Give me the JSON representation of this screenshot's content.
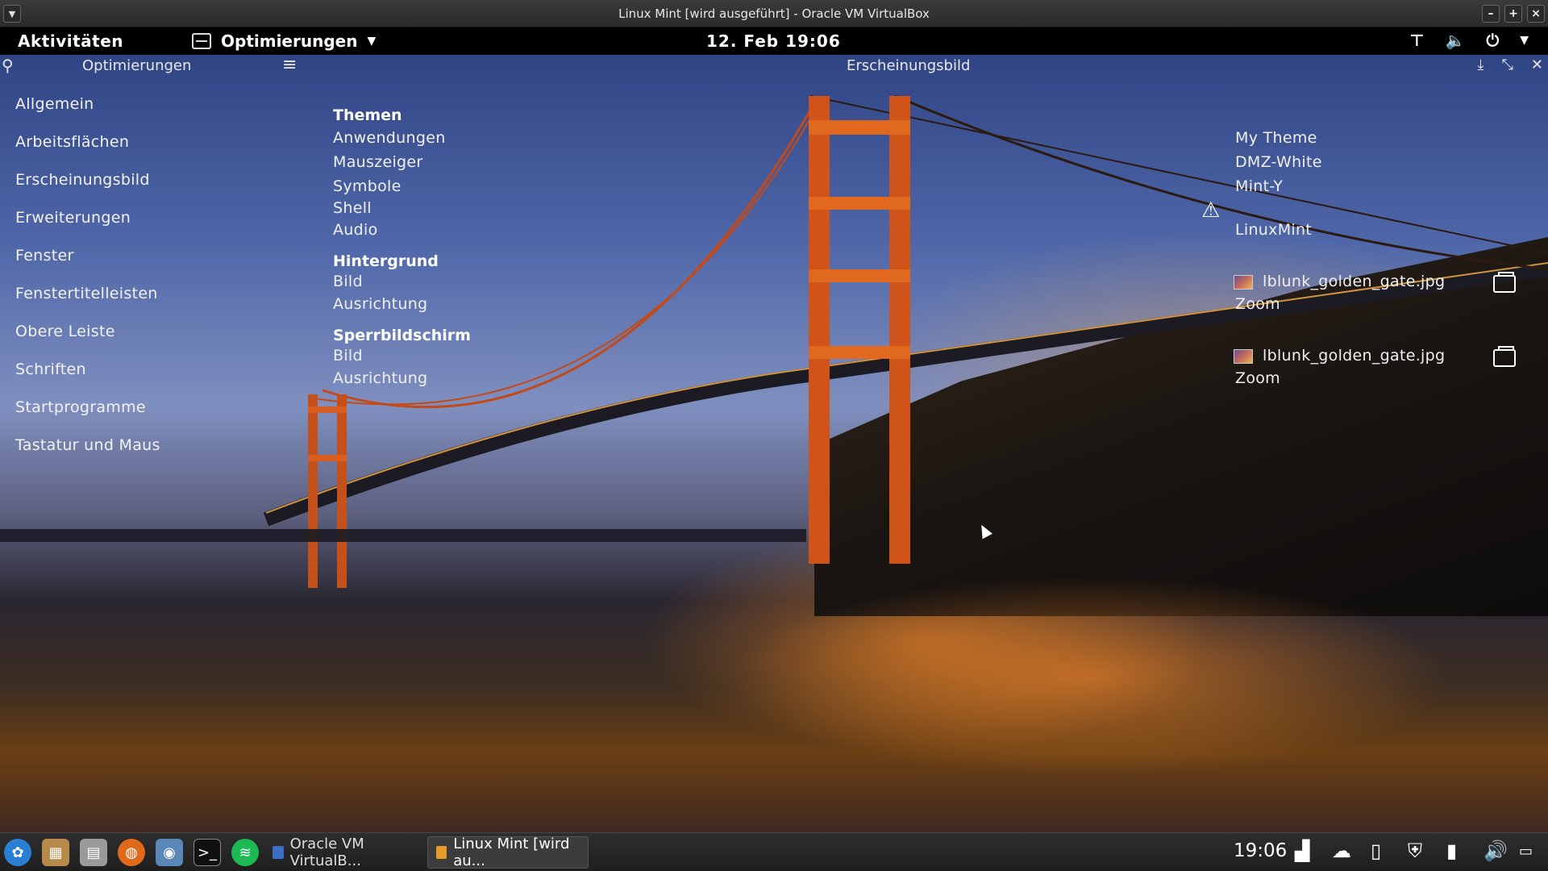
{
  "host_window": {
    "title": "Linux Mint [wird ausgeführt] - Oracle VM VirtualBox",
    "controls": [
      "–",
      "+",
      "×"
    ]
  },
  "topbar": {
    "activities": "Aktivitäten",
    "app_menu": "Optimierungen",
    "clock": "12. Feb  19:06"
  },
  "tweaks": {
    "sidebar_title": "Optimierungen",
    "main_title": "Erscheinungsbild",
    "sidebar_items": [
      "Allgemein",
      "Arbeitsflächen",
      "Erscheinungsbild",
      "Erweiterungen",
      "Fenster",
      "Fenstertitelleisten",
      "Obere Leiste",
      "Schriften",
      "Startprogramme",
      "Tastatur und Maus"
    ],
    "themes": {
      "header": "Themen",
      "applications_label": "Anwendungen",
      "applications_value": "My Theme",
      "cursor_label": "Mauszeiger",
      "cursor_value": "DMZ-White",
      "icons_label": "Symbole",
      "icons_value": "Mint-Y",
      "shell_label": "Shell",
      "audio_label": "Audio",
      "audio_value": "LinuxMint"
    },
    "background": {
      "header": "Hintergrund",
      "image_label": "Bild",
      "image_value": "lblunk_golden_gate.jpg",
      "adjustment_label": "Ausrichtung",
      "adjustment_value": "Zoom"
    },
    "lockscreen": {
      "header": "Sperrbildschirm",
      "image_label": "Bild",
      "image_value": "lblunk_golden_gate.jpg",
      "adjustment_label": "Ausrichtung",
      "adjustment_value": "Zoom"
    }
  },
  "panel": {
    "tasks": [
      {
        "label": "Oracle VM VirtualB..."
      },
      {
        "label": "Linux Mint [wird au..."
      }
    ],
    "time": "19:06"
  }
}
